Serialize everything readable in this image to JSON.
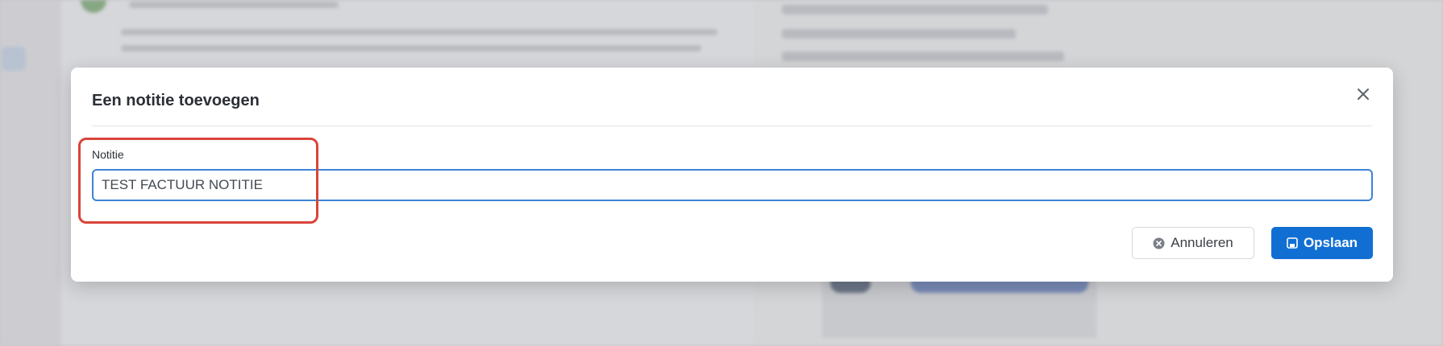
{
  "modal": {
    "title": "Een notitie toevoegen",
    "close_icon": "close-icon",
    "field_label": "Notitie",
    "note_value": "TEST FACTUUR NOTITIE",
    "cancel_label": "Annuleren",
    "cancel_icon": "x-circle-icon",
    "save_label": "Opslaan",
    "save_icon": "floppy-disk-icon"
  },
  "colors": {
    "accent": "#116fd4",
    "input_border": "#3b84d6",
    "highlight": "#d9443a"
  }
}
